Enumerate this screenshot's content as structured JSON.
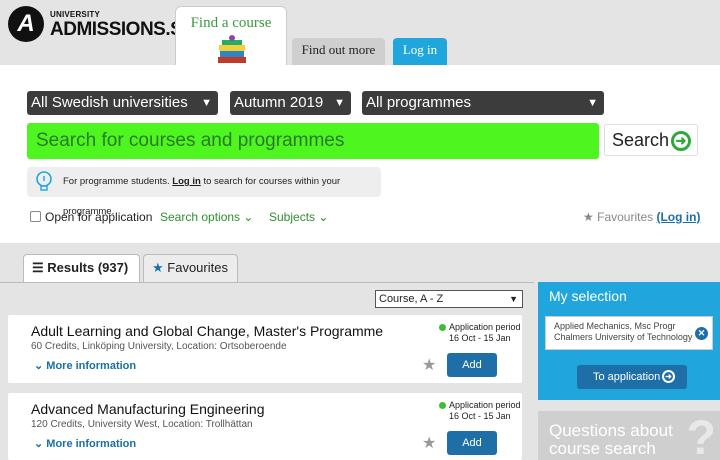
{
  "logo": {
    "mark": "A",
    "small": "UNIVERSITY",
    "big": "ADMISSIONS.SE"
  },
  "nav": {
    "find_course": "Find a course",
    "find_out_more": "Find out more",
    "login": "Log in"
  },
  "filters": {
    "university": "All Swedish universities",
    "semester": "Autumn 2019",
    "programme": "All programmes"
  },
  "search": {
    "placeholder": "Search for courses and programmes",
    "button": "Search"
  },
  "info": {
    "pre": "For programme students.",
    "link": "Log in",
    "post": "to search for courses within your programme."
  },
  "options": {
    "open_for_application": "Open for application",
    "search_options": "Search options",
    "subjects": "Subjects",
    "favourites": "Favourites",
    "favourites_login": "(Log in)"
  },
  "results_tabs": {
    "results": "Results (937)",
    "favourites": "Favourites"
  },
  "sort": {
    "selected": "Course, A - Z"
  },
  "results": [
    {
      "title": "Adult Learning and Global Change, Master's Programme",
      "meta": "60 Credits, Linköping University, Location:  Ortsoberoende",
      "more": "More information",
      "period_label": "Application period",
      "period": "16 Oct - 15 Jan",
      "add": "Add"
    },
    {
      "title": "Advanced Manufacturing Engineering",
      "meta": "120 Credits, University West, Location:  Trollhättan",
      "more": "More information",
      "period_label": "Application period",
      "period": "16 Oct - 15 Jan",
      "add": "Add"
    }
  ],
  "selection": {
    "heading": "My selection",
    "item_line1": "Applied Mechanics, Msc Progr",
    "item_line2": "Chalmers University of Technology",
    "apply": "To application"
  },
  "questions": {
    "line1": "Questions about",
    "line2": "course search"
  },
  "colors": {
    "search_green": "#4ef51e",
    "accent_blue": "#20a6dc",
    "button_blue": "#1e6fa8",
    "link_green": "#2f8f2f"
  },
  "icons": {
    "info": "lightbulb-icon",
    "favourite": "star-icon",
    "list": "list-icon",
    "go": "arrow-circle-icon",
    "remove": "close-icon"
  }
}
